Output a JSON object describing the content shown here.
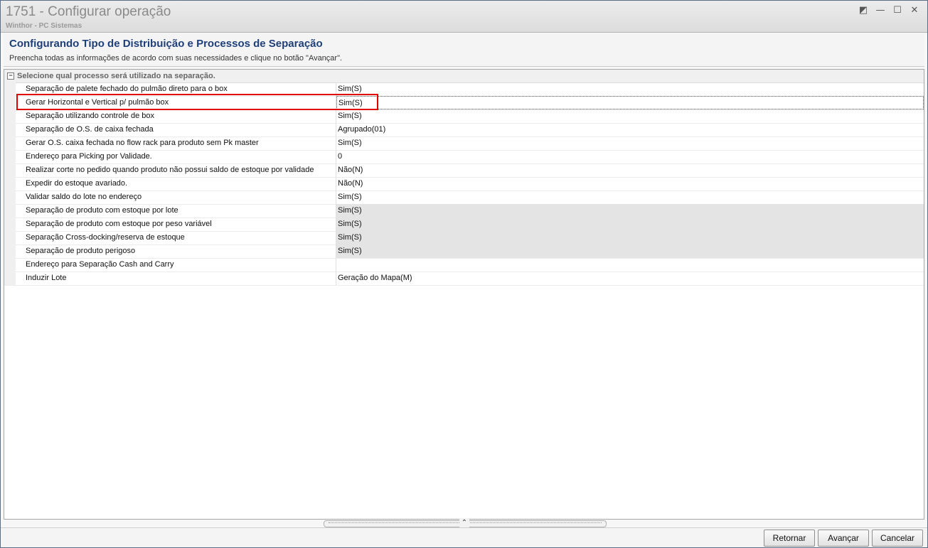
{
  "window": {
    "title": "1751 - Configurar operação",
    "subtitle": "Winthor - PC Sistemas",
    "controls": [
      {
        "name": "restore-icon",
        "glyph": "◩"
      },
      {
        "name": "minimize-icon",
        "glyph": "—"
      },
      {
        "name": "maximize-icon",
        "glyph": "☐"
      },
      {
        "name": "close-icon",
        "glyph": "✕"
      }
    ]
  },
  "header": {
    "title": "Configurando Tipo de Distribuição e Processos de Separação",
    "description": "Preencha todas as informações de acordo com suas necessidades e clique no botão \"Avançar\"."
  },
  "grid": {
    "category": "Selecione qual processo será utilizado na separação.",
    "category_toggle": "−",
    "rows": [
      {
        "label": "Separação de palete fechado do pulmão direto para o box",
        "value": "Sim(S)",
        "readonly": false,
        "selected": false
      },
      {
        "label": "Gerar Horizontal e Vertical p/ pulmão box",
        "value": "Sim(S)",
        "readonly": false,
        "selected": true
      },
      {
        "label": "Separação utilizando controle de box",
        "value": "Sim(S)",
        "readonly": false,
        "selected": false
      },
      {
        "label": "Separação de O.S. de caixa fechada",
        "value": "Agrupado(01)",
        "readonly": false,
        "selected": false
      },
      {
        "label": "Gerar O.S. caixa fechada no flow rack para produto sem Pk master",
        "value": "Sim(S)",
        "readonly": false,
        "selected": false
      },
      {
        "label": "Endereço para Picking por Validade.",
        "value": "0",
        "readonly": false,
        "selected": false
      },
      {
        "label": "Realizar corte no pedido quando produto não possui saldo de estoque por validade",
        "value": "Não(N)",
        "readonly": false,
        "selected": false
      },
      {
        "label": "Expedir do estoque avariado.",
        "value": "Não(N)",
        "readonly": false,
        "selected": false
      },
      {
        "label": "Validar saldo do lote no endereço",
        "value": "Sim(S)",
        "readonly": false,
        "selected": false
      },
      {
        "label": "Separação de produto com estoque por lote",
        "value": "Sim(S)",
        "readonly": true,
        "selected": false
      },
      {
        "label": "Separação de produto com estoque por peso variável",
        "value": "Sim(S)",
        "readonly": true,
        "selected": false
      },
      {
        "label": "Separação Cross-docking/reserva de estoque",
        "value": "Sim(S)",
        "readonly": true,
        "selected": false
      },
      {
        "label": "Separação de produto perigoso",
        "value": "Sim(S)",
        "readonly": true,
        "selected": false
      },
      {
        "label": "Endereço para Separação Cash and Carry",
        "value": "",
        "readonly": false,
        "selected": false
      },
      {
        "label": "Induzir Lote",
        "value": "Geração do Mapa(M)",
        "readonly": false,
        "selected": false
      }
    ]
  },
  "splitter": {
    "arrow": "⌃"
  },
  "footer": {
    "buttons": [
      {
        "name": "retornar-button",
        "label": "Retornar"
      },
      {
        "name": "avancar-button",
        "label": "Avançar"
      },
      {
        "name": "cancelar-button",
        "label": "Cancelar"
      }
    ]
  },
  "colors": {
    "title_blue": "#1e3f7a",
    "highlight_red": "#e00000",
    "readonly_gray": "#e4e4e4"
  }
}
